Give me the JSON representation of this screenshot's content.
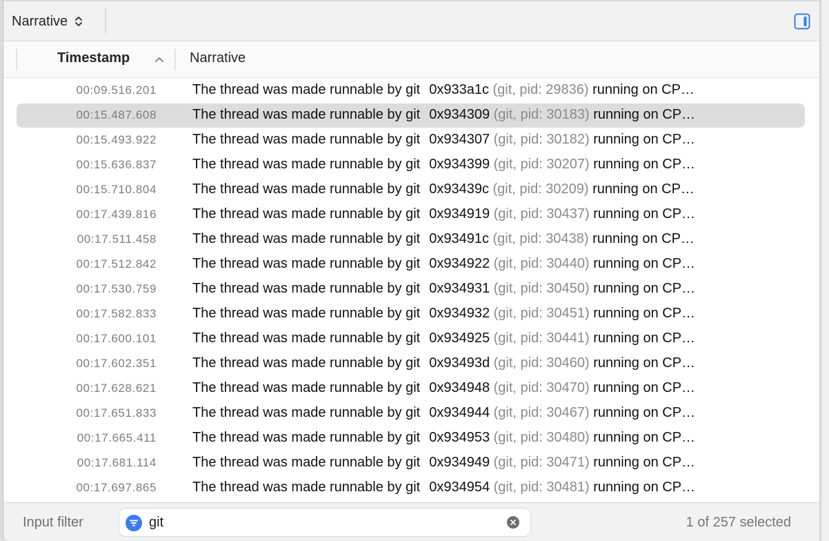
{
  "toolbar": {
    "view_selector_label": "Narrative",
    "icons": {
      "view_selector": "chevron-up-down-icon",
      "sidebar_toggle": "sidebar-right-icon"
    }
  },
  "table": {
    "columns": [
      {
        "label": "Timestamp",
        "sorted": "ascending"
      },
      {
        "label": "Narrative"
      }
    ],
    "selected_index": 1,
    "rows": [
      {
        "timestamp": "00:09.516.201",
        "text": "The thread was made runnable by git",
        "thread": "0x933a1c",
        "process": "(git, pid: 29836)",
        "suffix": "running on CP…"
      },
      {
        "timestamp": "00:15.487.608",
        "text": "The thread was made runnable by git",
        "thread": "0x934309",
        "process": "(git, pid: 30183)",
        "suffix": "running on CP…"
      },
      {
        "timestamp": "00:15.493.922",
        "text": "The thread was made runnable by git",
        "thread": "0x934307",
        "process": "(git, pid: 30182)",
        "suffix": "running on CP…"
      },
      {
        "timestamp": "00:15.636.837",
        "text": "The thread was made runnable by git",
        "thread": "0x934399",
        "process": "(git, pid: 30207)",
        "suffix": "running on CP…"
      },
      {
        "timestamp": "00:15.710.804",
        "text": "The thread was made runnable by git",
        "thread": "0x93439c",
        "process": "(git, pid: 30209)",
        "suffix": "running on CP…"
      },
      {
        "timestamp": "00:17.439.816",
        "text": "The thread was made runnable by git",
        "thread": "0x934919",
        "process": "(git, pid: 30437)",
        "suffix": "running on CP…"
      },
      {
        "timestamp": "00:17.511.458",
        "text": "The thread was made runnable by git",
        "thread": "0x93491c",
        "process": "(git, pid: 30438)",
        "suffix": "running on CP…"
      },
      {
        "timestamp": "00:17.512.842",
        "text": "The thread was made runnable by git",
        "thread": "0x934922",
        "process": "(git, pid: 30440)",
        "suffix": "running on CP…"
      },
      {
        "timestamp": "00:17.530.759",
        "text": "The thread was made runnable by git",
        "thread": "0x934931",
        "process": "(git, pid: 30450)",
        "suffix": "running on CP…"
      },
      {
        "timestamp": "00:17.582.833",
        "text": "The thread was made runnable by git",
        "thread": "0x934932",
        "process": "(git, pid: 30451)",
        "suffix": "running on CP…"
      },
      {
        "timestamp": "00:17.600.101",
        "text": "The thread was made runnable by git",
        "thread": "0x934925",
        "process": "(git, pid: 30441)",
        "suffix": "running on CP…"
      },
      {
        "timestamp": "00:17.602.351",
        "text": "The thread was made runnable by git",
        "thread": "0x93493d",
        "process": "(git, pid: 30460)",
        "suffix": "running on CP…"
      },
      {
        "timestamp": "00:17.628.621",
        "text": "The thread was made runnable by git",
        "thread": "0x934948",
        "process": "(git, pid: 30470)",
        "suffix": "running on CP…"
      },
      {
        "timestamp": "00:17.651.833",
        "text": "The thread was made runnable by git",
        "thread": "0x934944",
        "process": "(git, pid: 30467)",
        "suffix": "running on CP…"
      },
      {
        "timestamp": "00:17.665.411",
        "text": "The thread was made runnable by git",
        "thread": "0x934953",
        "process": "(git, pid: 30480)",
        "suffix": "running on CP…"
      },
      {
        "timestamp": "00:17.681.114",
        "text": "The thread was made runnable by git",
        "thread": "0x934949",
        "process": "(git, pid: 30471)",
        "suffix": "running on CP…"
      },
      {
        "timestamp": "00:17.697.865",
        "text": "The thread was made runnable by git",
        "thread": "0x934954",
        "process": "(git, pid: 30481)",
        "suffix": "running on CP…"
      }
    ]
  },
  "footer": {
    "filter_label": "Input filter",
    "filter_value": "git",
    "filter_placeholder": "",
    "selection_status": "1 of 257 selected",
    "icons": {
      "filter": "filter-icon",
      "clear": "clear-circle-icon"
    }
  },
  "colors": {
    "accent": "#3a7bf0",
    "selected_row": "#dcdcdc",
    "timestamp_text": "#7c7c7c",
    "process_text": "#8a8a8a"
  }
}
